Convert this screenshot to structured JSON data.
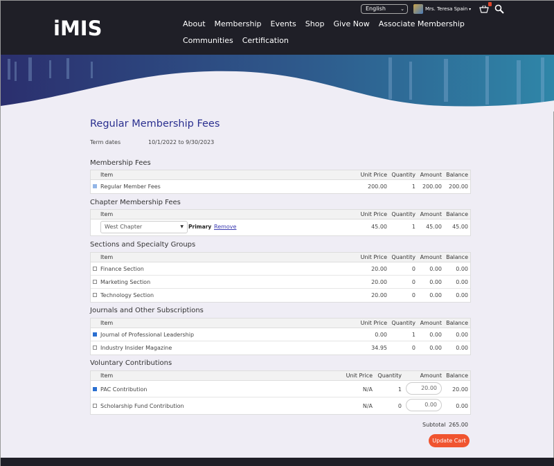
{
  "header": {
    "logo": "iMIS",
    "language": "English",
    "user_name": "Mrs. Teresa Spain",
    "nav": [
      "About",
      "Membership",
      "Events",
      "Shop",
      "Give Now",
      "Associate Membership",
      "Communities",
      "Certification"
    ]
  },
  "page": {
    "title": "Regular Membership Fees",
    "term_label": "Term dates",
    "term_value": "10/1/2022 to 9/30/2023"
  },
  "columns": {
    "item": "Item",
    "unit_price": "Unit Price",
    "quantity": "Quantity",
    "amount": "Amount",
    "balance": "Balance"
  },
  "membership_fees": {
    "heading": "Membership Fees",
    "rows": [
      {
        "item": "Regular Member Fees",
        "unit_price": "200.00",
        "quantity": "1",
        "amount": "200.00",
        "balance": "200.00",
        "checked": true,
        "disabled": true
      }
    ]
  },
  "chapter_fees": {
    "heading": "Chapter Membership Fees",
    "chapter": "West Chapter",
    "primary": "Primary",
    "remove": "Remove",
    "unit_price": "45.00",
    "quantity": "1",
    "amount": "45.00",
    "balance": "45.00"
  },
  "sections": {
    "heading": "Sections and Specialty Groups",
    "rows": [
      {
        "item": "Finance Section",
        "unit_price": "20.00",
        "quantity": "0",
        "amount": "0.00",
        "balance": "0.00"
      },
      {
        "item": "Marketing Section",
        "unit_price": "20.00",
        "quantity": "0",
        "amount": "0.00",
        "balance": "0.00"
      },
      {
        "item": "Technology Section",
        "unit_price": "20.00",
        "quantity": "0",
        "amount": "0.00",
        "balance": "0.00"
      }
    ]
  },
  "journals": {
    "heading": "Journals and Other Subscriptions",
    "rows": [
      {
        "item": "Journal of Professional Leadership",
        "unit_price": "0.00",
        "quantity": "1",
        "amount": "0.00",
        "balance": "0.00",
        "checked": true
      },
      {
        "item": "Industry Insider Magazine",
        "unit_price": "34.95",
        "quantity": "0",
        "amount": "0.00",
        "balance": "0.00"
      }
    ]
  },
  "contributions": {
    "heading": "Voluntary Contributions",
    "rows": [
      {
        "item": "PAC Contribution",
        "unit_price": "N/A",
        "quantity": "1",
        "amount": "20.00",
        "balance": "20.00",
        "checked": true
      },
      {
        "item": "Scholarship Fund Contribution",
        "unit_price": "N/A",
        "quantity": "0",
        "amount": "0.00",
        "balance": "0.00"
      }
    ]
  },
  "totals": {
    "subtotal_label": "Subtotal",
    "subtotal_value": "265.00",
    "update_button": "Update Cart"
  },
  "colors": {
    "header_bg": "#1f1f27",
    "title": "#2a2f8f",
    "accent_button": "#f0542f",
    "checkbox": "#2a6fd1",
    "page_bg": "#efedf5"
  }
}
